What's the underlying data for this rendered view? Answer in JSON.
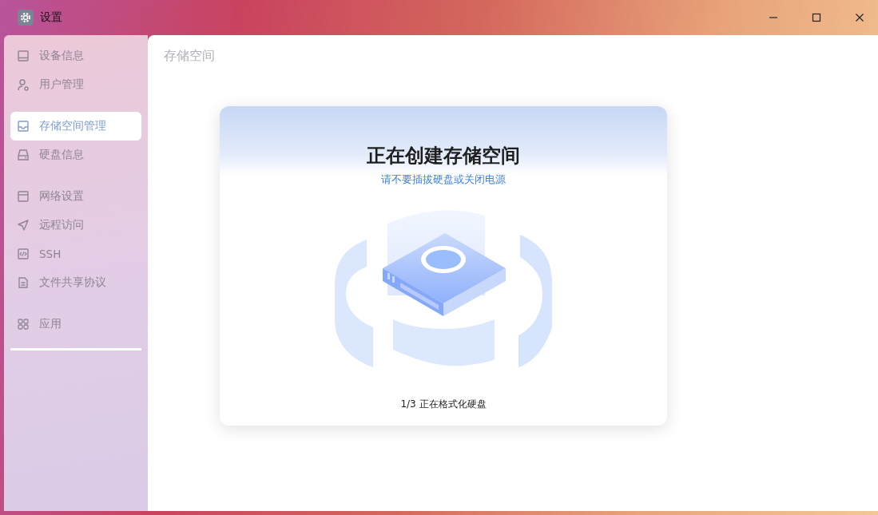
{
  "window": {
    "title": "设置"
  },
  "sidebar": {
    "groups": [
      {
        "items": [
          {
            "label": "设备信息",
            "selected": false
          },
          {
            "label": "用户管理",
            "selected": false
          }
        ]
      },
      {
        "items": [
          {
            "label": "存储空间管理",
            "selected": true
          },
          {
            "label": "硬盘信息",
            "selected": false
          }
        ]
      },
      {
        "items": [
          {
            "label": "网络设置",
            "selected": false
          },
          {
            "label": "远程访问",
            "selected": false
          },
          {
            "label": "SSH",
            "selected": false
          },
          {
            "label": "文件共享协议",
            "selected": false
          }
        ]
      },
      {
        "items": [
          {
            "label": "应用",
            "selected": false
          }
        ]
      }
    ]
  },
  "page": {
    "title": "存储空间"
  },
  "dialog": {
    "title": "正在创建存储空间",
    "subtitle": "请不要插拔硬盘或关闭电源",
    "step": "1/3 正在格式化硬盘"
  }
}
